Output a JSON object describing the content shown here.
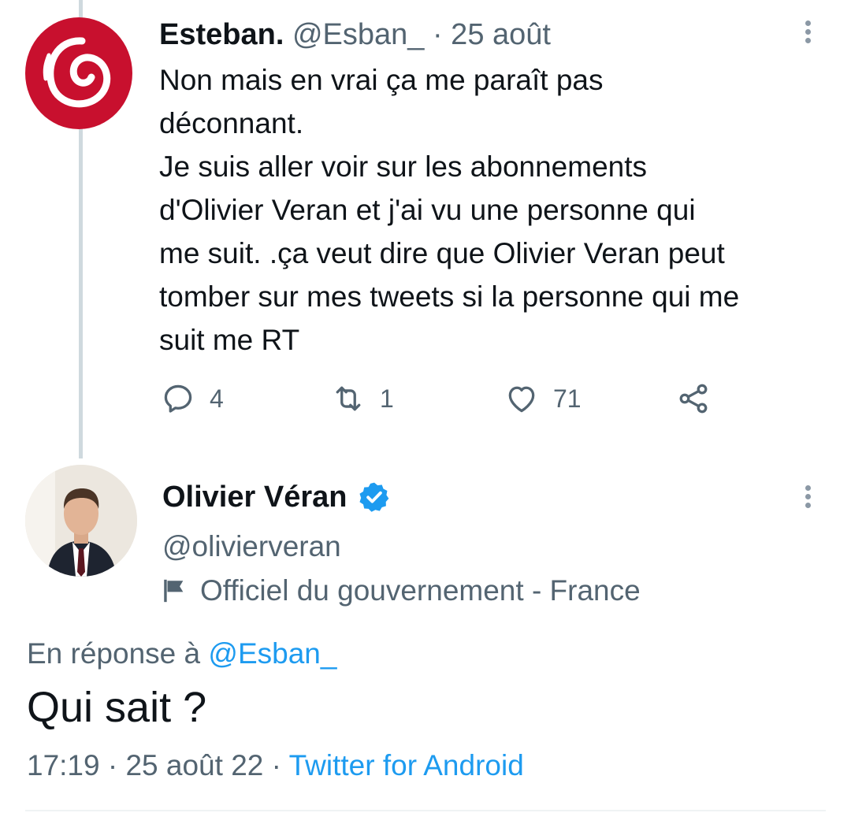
{
  "tweet1": {
    "name": "Esteban.",
    "meta": "@Esban_ · 25 août",
    "text": "Non mais en vrai ça me paraît pas\ndéconnant.\nJe suis aller voir sur les abonnements\nd'Olivier Veran et j'ai vu une personne qui\nme suit. .ça veut dire que Olivier Veran peut\ntomber sur mes tweets si la personne qui me\nsuit me RT",
    "replies": "4",
    "retweets": "1",
    "likes": "71"
  },
  "tweet2": {
    "name": "Olivier Véran",
    "handle": "@olivierveran",
    "label": "Officiel du gouvernement - France",
    "reply_prefix": "En réponse à",
    "reply_handle": "@Esban_",
    "text": "Qui sait ?",
    "time_date": "17:19 · 25 août 22 ·",
    "source": "Twitter for Android"
  },
  "icons": {
    "reply": "reply-icon",
    "retweet": "retweet-icon",
    "like": "heart-icon",
    "share": "share-icon",
    "more": "more-vertical-icon",
    "verified": "verified-badge-icon",
    "flag": "flag-icon"
  },
  "colors": {
    "accent": "#1d9bf0",
    "secondary_text": "#536471",
    "avatar_red": "#c8102e"
  }
}
